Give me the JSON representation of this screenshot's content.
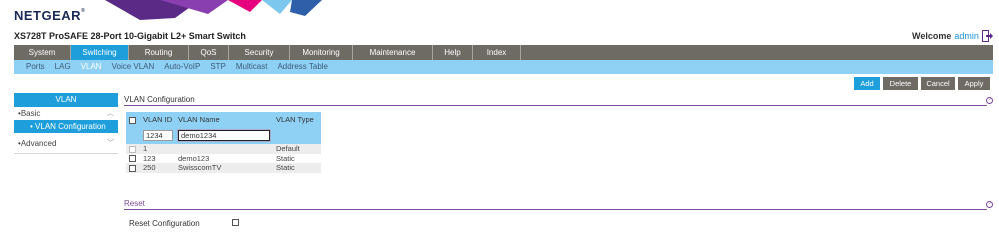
{
  "brand": {
    "logo_text": "NETGEAR",
    "tm": "®"
  },
  "header": {
    "product_title": "XS728T ProSAFE 28-Port 10-Gigabit L2+ Smart Switch",
    "welcome_label": "Welcome",
    "username": "admin"
  },
  "main_nav": [
    {
      "label": "System"
    },
    {
      "label": "Switching",
      "active": true
    },
    {
      "label": "Routing"
    },
    {
      "label": "QoS"
    },
    {
      "label": "Security"
    },
    {
      "label": "Monitoring"
    },
    {
      "label": "Maintenance"
    },
    {
      "label": "Help"
    },
    {
      "label": "Index"
    }
  ],
  "sub_nav": [
    {
      "label": "Ports"
    },
    {
      "label": "LAG"
    },
    {
      "label": "VLAN",
      "active": true
    },
    {
      "label": "Voice VLAN"
    },
    {
      "label": "Auto-VoIP"
    },
    {
      "label": "STP"
    },
    {
      "label": "Multicast"
    },
    {
      "label": "Address Table"
    }
  ],
  "actions": {
    "add": "Add",
    "delete": "Delete",
    "cancel": "Cancel",
    "apply": "Apply"
  },
  "sidebar": {
    "title": "VLAN",
    "basic": "Basic",
    "vlan_configuration": "VLAN Configuration",
    "advanced": "Advanced"
  },
  "vlan_config": {
    "title": "VLAN Configuration",
    "columns": [
      "VLAN ID",
      "VLAN Name",
      "VLAN Type"
    ],
    "new_row": {
      "vlan_id": "1234",
      "vlan_name": "demo1234"
    },
    "rows": [
      {
        "id": "1",
        "name": "",
        "type": "Default",
        "checkbox_disabled": true
      },
      {
        "id": "123",
        "name": "demo123",
        "type": "Static",
        "checkbox_disabled": false
      },
      {
        "id": "250",
        "name": "SwisscomTV",
        "type": "Static",
        "checkbox_disabled": false
      }
    ]
  },
  "reset": {
    "title": "Reset",
    "label": "Reset Configuration",
    "checked": false
  },
  "colors": {
    "nav_bg": "#6e6a64",
    "accent_blue": "#1e9fdc",
    "subnav_bg": "#8fd1f4",
    "section_purple": "#7a4a9c",
    "logo_navy": "#1b2b55"
  },
  "icons": {
    "logout": "logout-icon",
    "help": "help-icon",
    "chevron_up": "chevron-up-icon",
    "chevron_down": "chevron-down-icon"
  }
}
